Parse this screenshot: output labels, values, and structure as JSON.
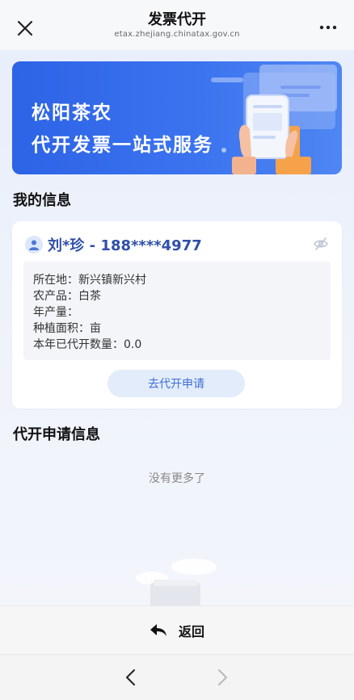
{
  "header": {
    "title": "发票代开",
    "url": "etax.zhejiang.chinatax.gov.cn",
    "close_icon": "close-icon",
    "more_icon": "more-icon"
  },
  "banner": {
    "line1": "松阳茶农",
    "line2": "代开发票一站式服务"
  },
  "my_info": {
    "section_title": "我的信息",
    "user_display": "刘*珍 - 188****4977",
    "lines": [
      "所在地：新兴镇新兴村",
      "农产品：白茶",
      "年产量：",
      "种植面积：亩",
      "本年已代开数量：0.0"
    ],
    "apply_button": "去代开申请"
  },
  "applications": {
    "section_title": "代开申请信息",
    "empty_text": "没有更多了"
  },
  "bottom": {
    "back_label": "返回"
  },
  "colors": {
    "accent": "#3d6ed6",
    "banner": "#2d63e6",
    "name": "#2f4fa8"
  }
}
